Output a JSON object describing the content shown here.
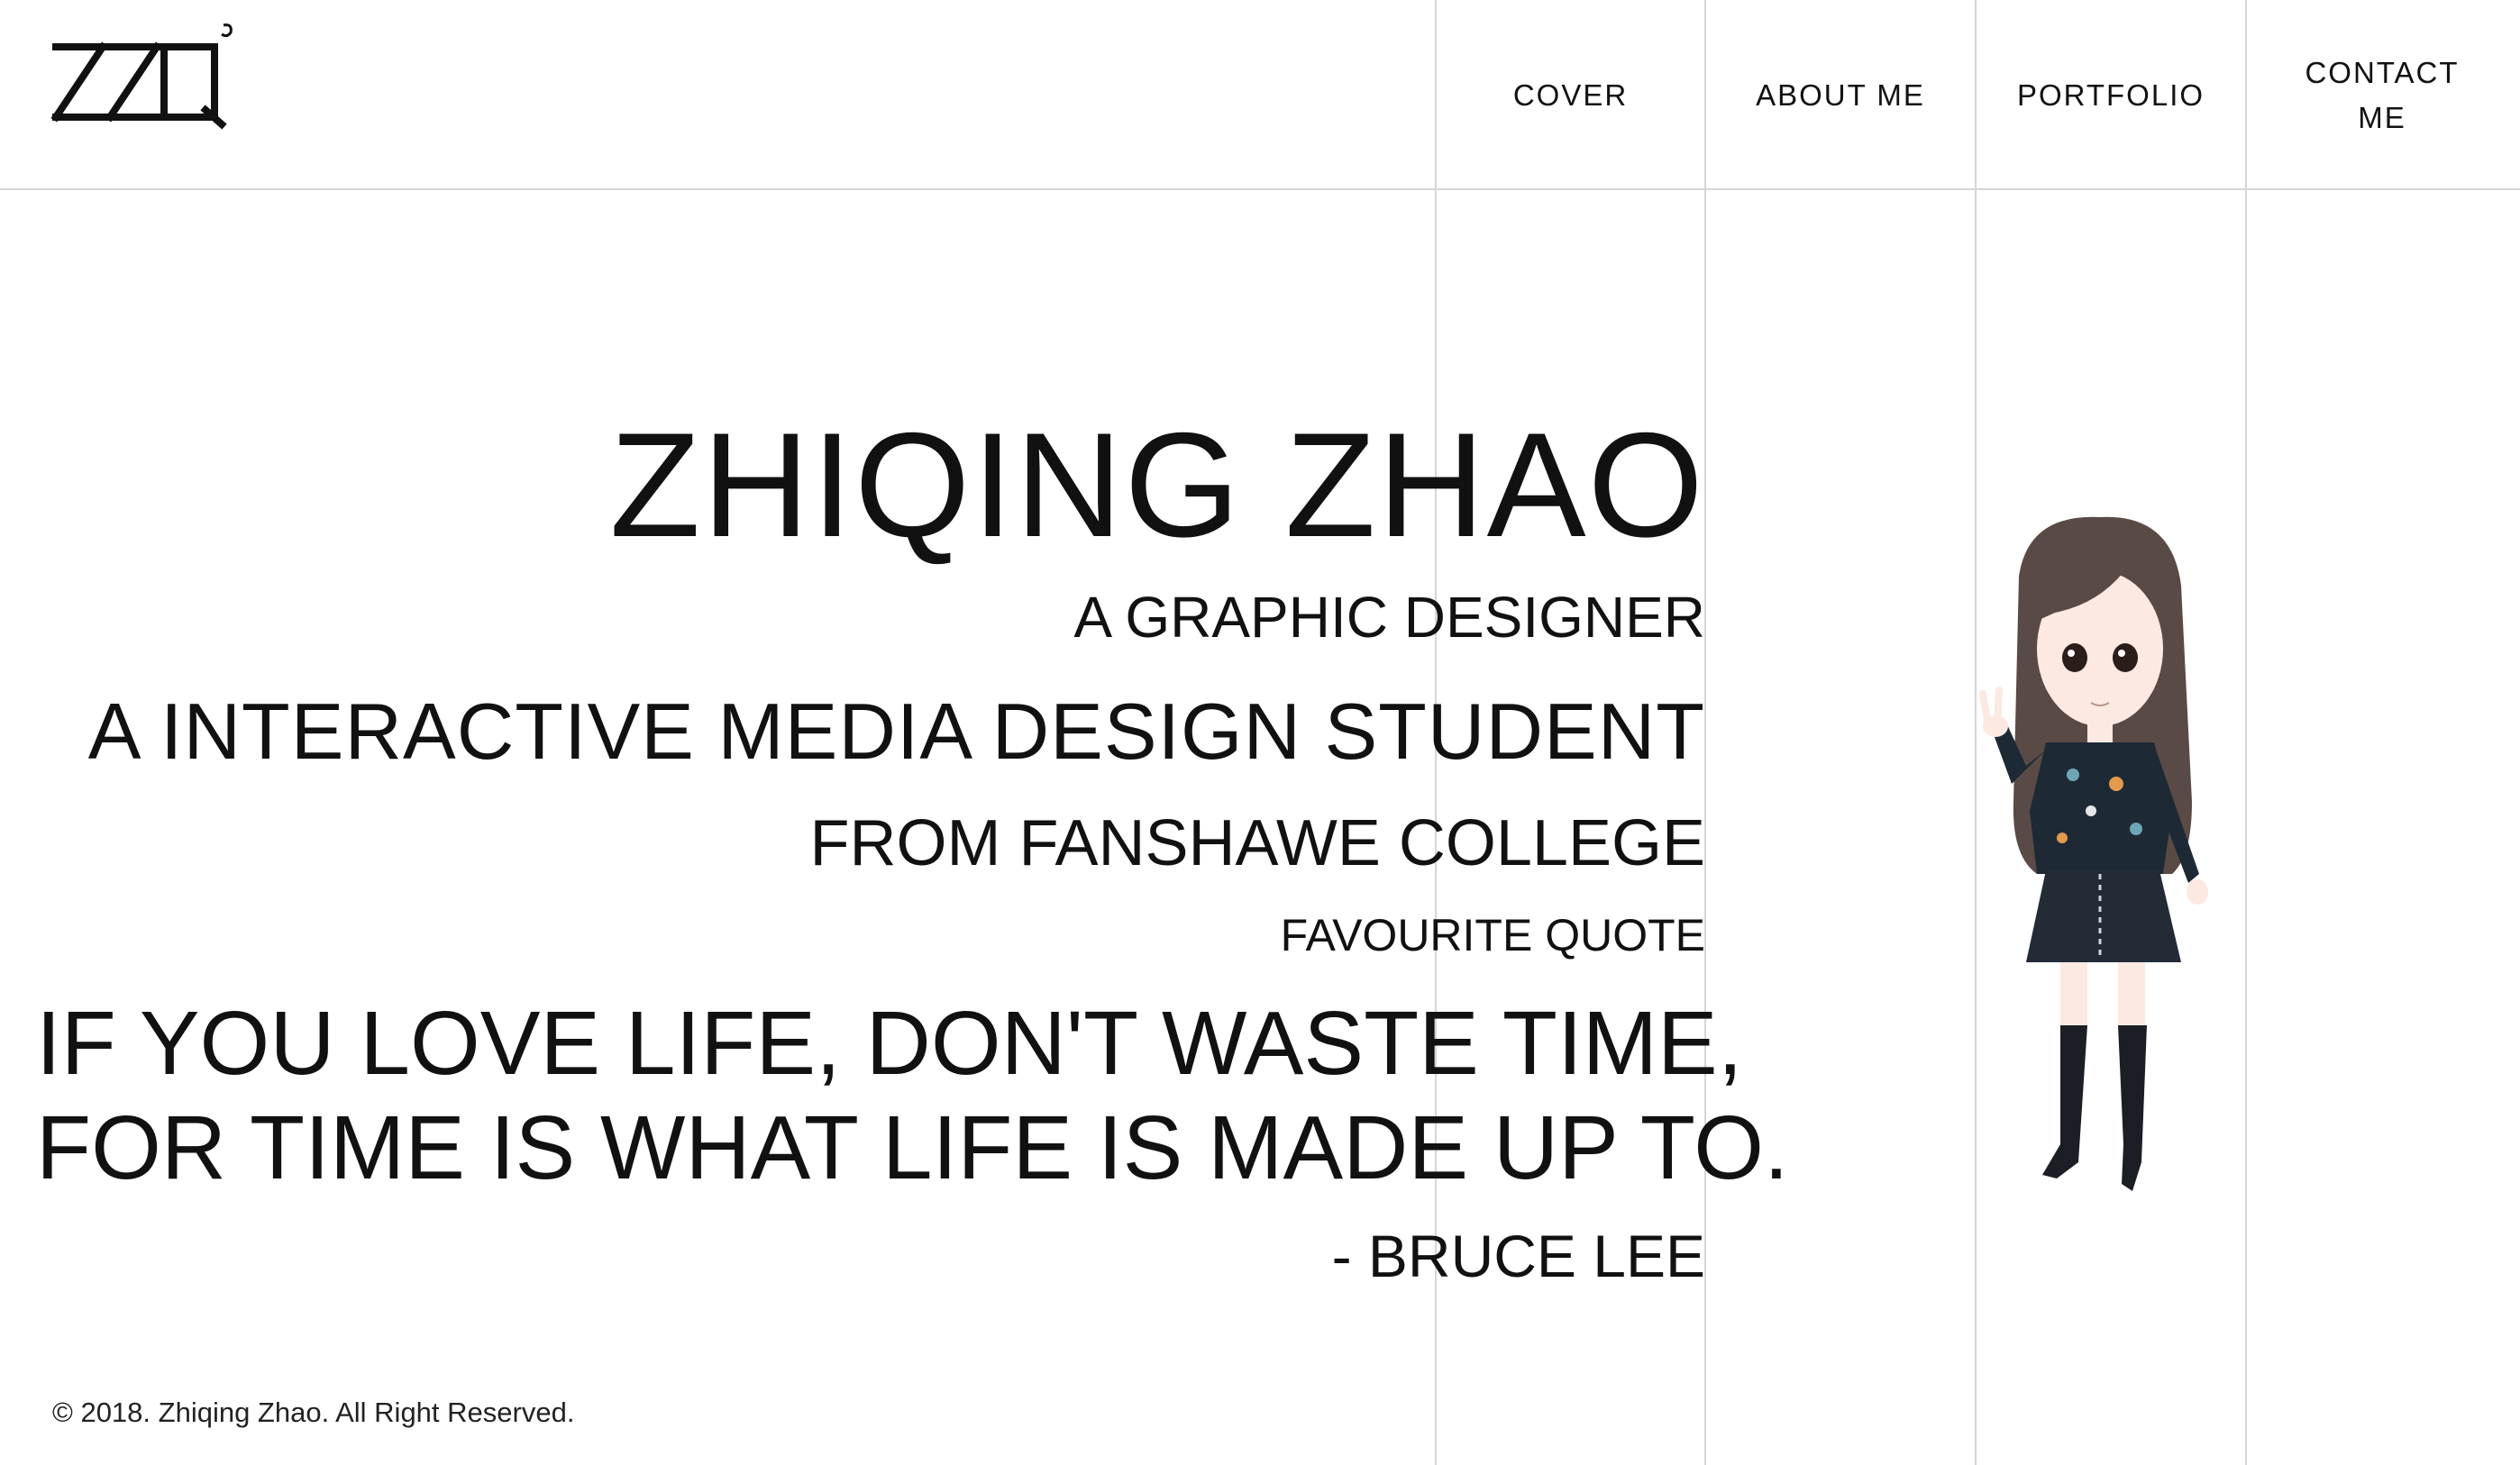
{
  "header": {
    "logo_icon": "zzq-logo-icon",
    "nav": [
      {
        "label": "COVER"
      },
      {
        "label": "ABOUT ME"
      },
      {
        "label": "PORTFOLIO"
      },
      {
        "label": "CONTACT ME"
      }
    ]
  },
  "hero": {
    "name": "ZHIQING ZHAO",
    "subtitle_1": "A GRAPHIC DESIGNER",
    "subtitle_2": "A INTERACTIVE MEDIA DESIGN STUDENT",
    "subtitle_3": "FROM FANSHAWE COLLEGE",
    "quote_label": "FAVOURITE QUOTE",
    "quote_line_1": "IF YOU LOVE LIFE, DON'T WASTE TIME,",
    "quote_line_2": "FOR TIME IS WHAT LIFE IS MADE UP TO.",
    "quote_author": "- BRUCE LEE"
  },
  "illustration": {
    "icon": "cartoon-girl-illustration"
  },
  "footer": {
    "copyright": "© 2018. Zhiqing Zhao. All Right Reserved."
  },
  "colors": {
    "text": "#111111",
    "grid_line": "#d6d6d6",
    "background": "#ffffff"
  }
}
